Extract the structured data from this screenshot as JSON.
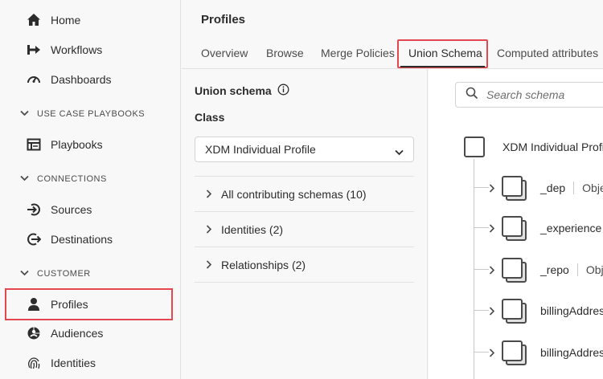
{
  "sidebar": {
    "items": [
      {
        "label": "Home",
        "icon": "home-icon"
      },
      {
        "label": "Workflows",
        "icon": "workflow-icon"
      },
      {
        "label": "Dashboards",
        "icon": "dashboard-icon"
      },
      {
        "label": "Playbooks",
        "icon": "playbook-icon"
      },
      {
        "label": "Sources",
        "icon": "sources-icon"
      },
      {
        "label": "Destinations",
        "icon": "destinations-icon"
      },
      {
        "label": "Profiles",
        "icon": "profile-icon"
      },
      {
        "label": "Audiences",
        "icon": "audiences-icon"
      },
      {
        "label": "Identities",
        "icon": "fingerprint-icon"
      }
    ],
    "sections": [
      {
        "label": "USE CASE PLAYBOOKS"
      },
      {
        "label": "CONNECTIONS"
      },
      {
        "label": "CUSTOMER"
      }
    ],
    "selected": "Profiles"
  },
  "header": {
    "title": "Profiles",
    "tabs": [
      {
        "label": "Overview"
      },
      {
        "label": "Browse"
      },
      {
        "label": "Merge Policies"
      },
      {
        "label": "Union Schema"
      },
      {
        "label": "Computed attributes"
      }
    ],
    "active_tab": "Union Schema"
  },
  "left_panel": {
    "title": "Union schema",
    "class_label": "Class",
    "class_value": "XDM Individual Profile",
    "accordions": [
      {
        "label": "All contributing schemas (10)"
      },
      {
        "label": "Identities (2)"
      },
      {
        "label": "Relationships (2)"
      }
    ]
  },
  "right_panel": {
    "search_placeholder": "Search schema",
    "root": "XDM Individual Profile",
    "nodes": [
      {
        "name": "_dep",
        "type": "Obje"
      },
      {
        "name": "_experience",
        "type": ""
      },
      {
        "name": "_repo",
        "type": "Obj"
      },
      {
        "name": "billingAddress",
        "type": ""
      },
      {
        "name": "billingAddress",
        "type": ""
      }
    ]
  },
  "colors": {
    "highlight": "#e34850",
    "text": "#2c2c2c",
    "background": "#f8f8f8"
  }
}
